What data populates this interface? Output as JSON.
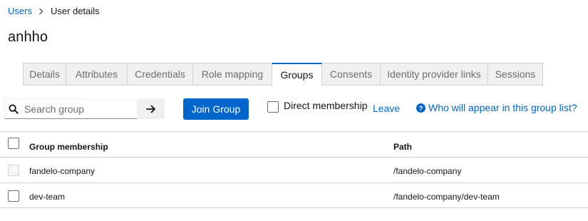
{
  "breadcrumb": {
    "parent": "Users",
    "current": "User details"
  },
  "page": {
    "title": "anhho"
  },
  "tabs": [
    {
      "label": "Details"
    },
    {
      "label": "Attributes"
    },
    {
      "label": "Credentials"
    },
    {
      "label": "Role mapping"
    },
    {
      "label": "Groups",
      "active": true
    },
    {
      "label": "Consents"
    },
    {
      "label": "Identity provider links"
    },
    {
      "label": "Sessions"
    }
  ],
  "toolbar": {
    "search_placeholder": "Search group",
    "search_value": "",
    "join_group_label": "Join Group",
    "direct_membership_label": "Direct membership",
    "direct_membership_checked": false,
    "leave_label": "Leave",
    "help_label": "Who will appear in this group list?"
  },
  "table": {
    "headers": {
      "name": "Group membership",
      "path": "Path"
    },
    "rows": [
      {
        "name": "fandelo-company",
        "path": "/fandelo-company",
        "checkbox_disabled": true
      },
      {
        "name": "dev-team",
        "path": "/fandelo-company/dev-team",
        "checkbox_disabled": false
      }
    ]
  },
  "colors": {
    "accent": "#0066cc",
    "text": "#151515",
    "muted": "#6a6e73",
    "border": "#d2d2d2",
    "tab_bg": "#f0f0f0"
  },
  "icons": {
    "breadcrumb_separator": "chevron-right-icon",
    "search": "search-icon",
    "submit": "arrow-right-icon",
    "help": "question-circle-icon"
  }
}
